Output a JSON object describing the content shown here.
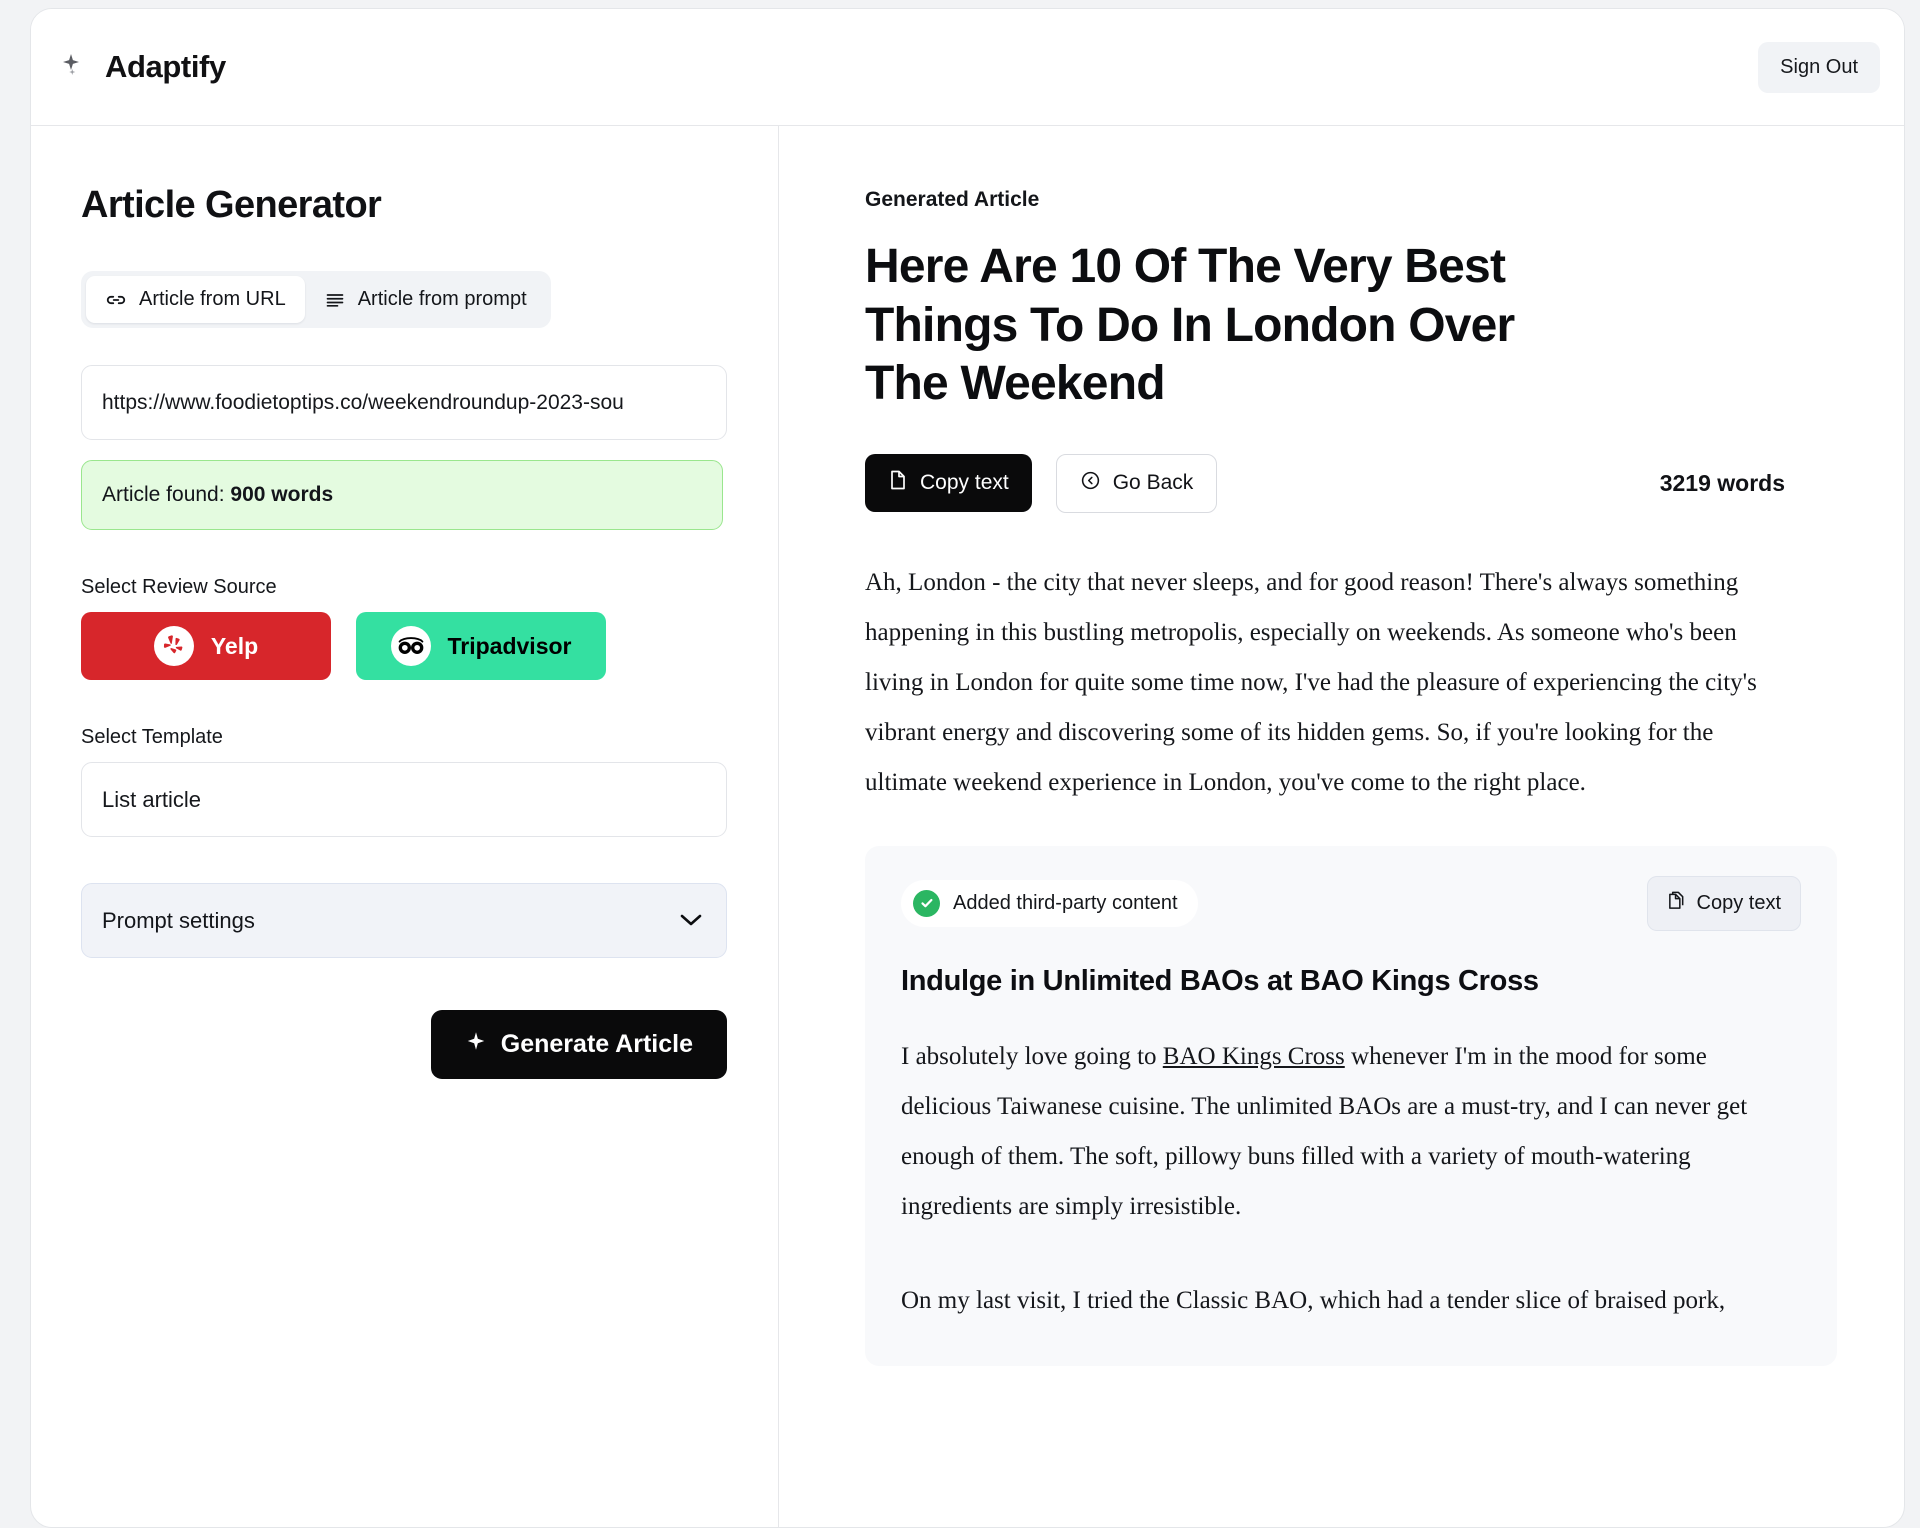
{
  "header": {
    "brand_name": "Adaptify",
    "brand_icon": "sparkles-icon",
    "signout_label": "Sign Out"
  },
  "left_panel": {
    "page_title": "Article Generator",
    "tabs": [
      {
        "label": "Article from URL",
        "icon": "link-icon",
        "active": true
      },
      {
        "label": "Article from prompt",
        "icon": "lines-icon",
        "active": false
      }
    ],
    "url_input": {
      "value": "https://www.foodietoptips.co/weekendroundup-2023-sou",
      "placeholder": "https://"
    },
    "alert": {
      "prefix": "Article found: ",
      "emphasis": "900 words",
      "bg_color": "#e4fbe0",
      "border_color": "#9ae68e"
    },
    "review_source": {
      "label": "Select Review Source",
      "options": [
        {
          "label": "Yelp",
          "color": "#d7262b",
          "text_color": "#ffffff",
          "icon": "yelp-icon"
        },
        {
          "label": "Tripadvisor",
          "color": "#34e0a1",
          "text_color": "#000000",
          "icon": "tripadvisor-owl-icon"
        }
      ]
    },
    "template": {
      "label": "Select Template",
      "selected": "List article"
    },
    "prompt_settings": {
      "label": "Prompt settings",
      "icon": "chevron-down-icon"
    },
    "generate_button": {
      "label": "Generate Article",
      "icon": "sparkle-icon"
    }
  },
  "right_panel": {
    "section_label": "Generated Article",
    "article_title": "Here Are 10 Of The Very Best Things To Do In London Over The Weekend",
    "copy_text_label": "Copy text",
    "go_back_label": "Go Back",
    "word_count": "3219 words",
    "intro_paragraph": "Ah, London - the city that never sleeps, and for good reason! There's always something happening in this bustling metropolis, especially on weekends. As someone who's been living in London for quite some time now, I've had the pleasure of experiencing the city's vibrant energy and discovering some of its hidden gems. So, if you're looking for the ultimate weekend experience in London, you've come to the right place.",
    "third_party": {
      "badge_label": "Added third-party content",
      "badge_icon": "check-circle-icon",
      "copy_text_label": "Copy text",
      "heading": "Indulge in Unlimited BAOs at BAO Kings Cross",
      "paragraph_1_before_link": "I absolutely love going to ",
      "link_text": "BAO Kings Cross",
      "paragraph_1_after_link": " whenever I'm in the mood for some delicious Taiwanese cuisine. The unlimited BAOs are a must-try, and I can never get enough of them. The soft, pillowy buns filled with a variety of mouth-watering ingredients are simply irresistible.",
      "paragraph_2": "On my last visit, I tried the Classic BAO, which had a tender slice of braised pork,"
    }
  }
}
